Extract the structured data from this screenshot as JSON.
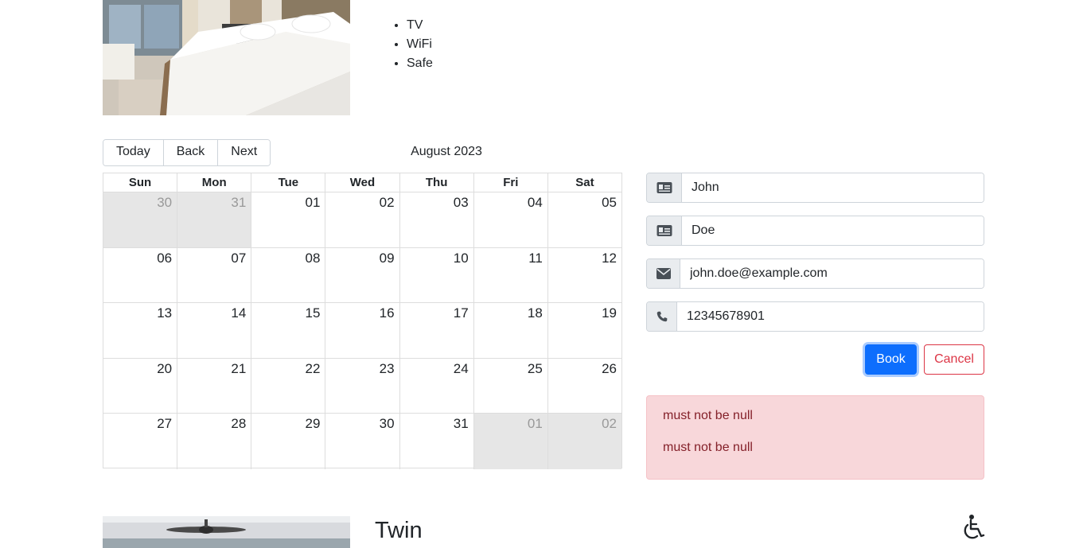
{
  "room1": {
    "features": [
      "TV",
      "WiFi",
      "Safe"
    ]
  },
  "calendar": {
    "toolbar": {
      "today": "Today",
      "back": "Back",
      "next": "Next"
    },
    "month_label": "August 2023",
    "weekdays": [
      "Sun",
      "Mon",
      "Tue",
      "Wed",
      "Thu",
      "Fri",
      "Sat"
    ],
    "weeks": [
      [
        {
          "d": "30",
          "off": true
        },
        {
          "d": "31",
          "off": true
        },
        {
          "d": "01"
        },
        {
          "d": "02"
        },
        {
          "d": "03"
        },
        {
          "d": "04"
        },
        {
          "d": "05"
        }
      ],
      [
        {
          "d": "06"
        },
        {
          "d": "07"
        },
        {
          "d": "08"
        },
        {
          "d": "09"
        },
        {
          "d": "10"
        },
        {
          "d": "11"
        },
        {
          "d": "12"
        }
      ],
      [
        {
          "d": "13"
        },
        {
          "d": "14"
        },
        {
          "d": "15"
        },
        {
          "d": "16"
        },
        {
          "d": "17"
        },
        {
          "d": "18"
        },
        {
          "d": "19"
        }
      ],
      [
        {
          "d": "20"
        },
        {
          "d": "21"
        },
        {
          "d": "22"
        },
        {
          "d": "23"
        },
        {
          "d": "24"
        },
        {
          "d": "25"
        },
        {
          "d": "26"
        }
      ],
      [
        {
          "d": "27"
        },
        {
          "d": "28"
        },
        {
          "d": "29"
        },
        {
          "d": "30"
        },
        {
          "d": "31"
        },
        {
          "d": "01",
          "off": true
        },
        {
          "d": "02",
          "off": true
        }
      ]
    ]
  },
  "form": {
    "firstname": {
      "value": "John",
      "icon": "id-card-icon"
    },
    "lastname": {
      "value": "Doe",
      "icon": "id-card-icon"
    },
    "email": {
      "value": "john.doe@example.com",
      "icon": "envelope-icon"
    },
    "phone": {
      "value": "12345678901",
      "icon": "phone-icon"
    },
    "book_label": "Book",
    "cancel_label": "Cancel"
  },
  "errors": [
    "must not be null",
    "must not be null"
  ],
  "room2": {
    "title": "Twin",
    "icon": "wheelchair-icon"
  },
  "colors": {
    "primary": "#0d6efd",
    "danger": "#dc3545",
    "alert_bg": "#f8d7da",
    "alert_text": "#842029",
    "off_day_bg": "#e6e6e6"
  }
}
